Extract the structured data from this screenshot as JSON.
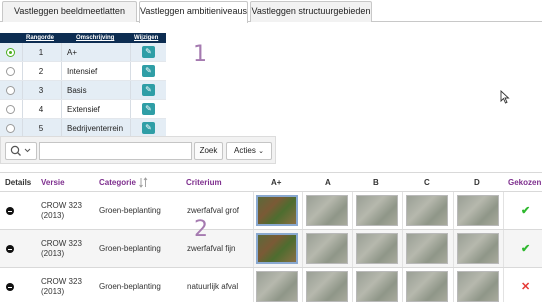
{
  "tabs": [
    {
      "label": "Vastleggen beeldmeetlatten",
      "active": false
    },
    {
      "label": "Vastleggen ambitieniveaus",
      "active": true
    },
    {
      "label": "Vastleggen structuurgebieden",
      "active": false
    }
  ],
  "levels_grid": {
    "headers": {
      "rank": "Rangorde",
      "description": "Omschrijving",
      "edit": "Wijzigen"
    },
    "rows": [
      {
        "rank": "1",
        "description": "A+",
        "selected": true
      },
      {
        "rank": "2",
        "description": "Intensief",
        "selected": false
      },
      {
        "rank": "3",
        "description": "Basis",
        "selected": false
      },
      {
        "rank": "4",
        "description": "Extensief",
        "selected": false
      },
      {
        "rank": "5",
        "description": "Bedrijventerrein",
        "selected": false
      }
    ]
  },
  "annotations": {
    "one": "1",
    "two": "2"
  },
  "search": {
    "value": "",
    "placeholder": "",
    "search_label": "Zoek",
    "actions_label": "Acties"
  },
  "main_table": {
    "headers": {
      "details": "Details",
      "version": "Versie",
      "category": "Categorie",
      "criterion": "Criterium",
      "a_plus": "A+",
      "a": "A",
      "b": "B",
      "c": "C",
      "d": "D",
      "chosen": "Gekozen"
    },
    "rows": [
      {
        "version_line1": "CROW 323",
        "version_line2": "(2013)",
        "category": "Groen-beplanting",
        "criterion": "zwerfafval grof",
        "chosen": "✔",
        "chosen_ok": true
      },
      {
        "version_line1": "CROW 323",
        "version_line2": "(2013)",
        "category": "Groen-beplanting",
        "criterion": "zwerfafval fijn",
        "chosen": "✔",
        "chosen_ok": true
      },
      {
        "version_line1": "CROW 323",
        "version_line2": "(2013)",
        "category": "Groen-beplanting",
        "criterion": "natuurlijk afval",
        "chosen": "✕",
        "chosen_ok": false
      }
    ]
  },
  "colors": {
    "accent_navy": "#0d2d52",
    "edit_teal": "#2f9ea6",
    "link_purple": "#7e2f8e",
    "ok_green": "#2eb82e",
    "error_red": "#e53935"
  }
}
